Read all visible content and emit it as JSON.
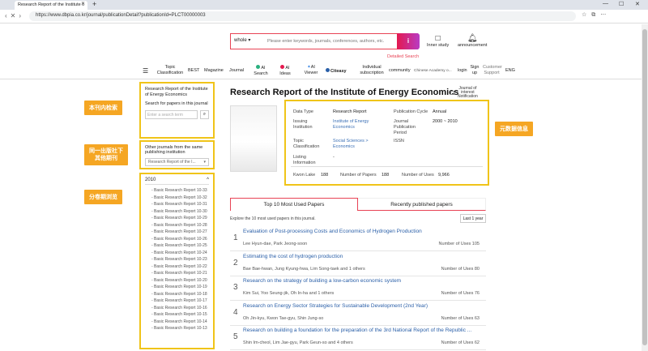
{
  "browser": {
    "tab_title": "Research Report of the Institute o",
    "url": "https://www.dbpia.co.kr/journal/publicationDetail?publicationId=PLCT00000003"
  },
  "search": {
    "scope": "whole",
    "placeholder": "Please enter keywords, journals, conferences, authors, etc.",
    "detailed": "Detailed Search"
  },
  "top_links": {
    "inner_study": "Inner study",
    "announcement": "announcement"
  },
  "menu": {
    "topic": "Topic Classification",
    "best": "BEST",
    "magazine": "Magazine",
    "journal": "Journal",
    "ai_search": "AI Search",
    "ai_ideas": "AI Ideas",
    "ai_viewer": "AI Viewer",
    "citeasy": "Citeasy",
    "individual": "Individual subscription",
    "community": "community",
    "academy": "Chinese Academy o...",
    "login": "login",
    "signup": "Sign up",
    "customer": "Customer Support",
    "lang": "ENG"
  },
  "sidebar": {
    "box1_title": "Research Report of the Institute of Energy Economics",
    "box1_sub": "Search for papers in this journal",
    "search_placeholder": "Enter a search term",
    "box2_title": "Other journals from the same publishing institution",
    "box2_select": "Research Report of the I...",
    "year": "2010",
    "volumes": [
      "Basic Research Report 10-33",
      "Basic Research Report 10-32",
      "Basic Research Report 10-31",
      "Basic Research Report 10-30",
      "Basic Research Report 10-29",
      "Basic Research Report 10-28",
      "Basic Research Report 10-27",
      "Basic Research Report 10-26",
      "Basic Research Report 10-25",
      "Basic Research Report 10-24",
      "Basic Research Report 10-23",
      "Basic Research Report 10-22",
      "Basic Research Report 10-21",
      "Basic Research Report 10-20",
      "Basic Research Report 10-19",
      "Basic Research Report 10-18",
      "Basic Research Report 10-17",
      "Basic Research Report 10-16",
      "Basic Research Report 10-15",
      "Basic Research Report 10-14",
      "Basic Research Report 10-13"
    ]
  },
  "annotations": {
    "a1": "本刊内检索",
    "a2": "同一出版社下其他期刊",
    "a3": "分卷期浏览",
    "a4": "元数据信息"
  },
  "journal": {
    "title": "Research Report of the Institute of Energy Economics",
    "notification": "Journal of interest Notification"
  },
  "meta": {
    "data_type_label": "Data Type",
    "data_type": "Research Report",
    "issuing_label": "Issuing Institution",
    "issuing": "Institute of Energy Economics",
    "topic_label": "Topic Classification",
    "topic": "Social Sciences > Economics",
    "listing_label": "Listing Information",
    "listing": "-",
    "cycle_label": "Publication Cycle",
    "cycle": "Annual",
    "period_label": "Journal Publication Period",
    "period": "2000 ~ 2010",
    "issn_label": "ISSN",
    "issn": "",
    "kwon_label": "Kwon Lake",
    "kwon": "188",
    "papers_label": "Number of Papers",
    "papers": "188",
    "uses_label": "Number of Uses",
    "uses": "9,966"
  },
  "tabs": {
    "top10": "Top 10 Most Used Papers",
    "recent": "Recently published papers"
  },
  "explore": "Explore the 10 most used papers in this journal.",
  "period_select": "Last 1 year",
  "papers": [
    {
      "num": "1",
      "title": "Evaluation of Post-processing Costs and Economics of Hydrogen Production",
      "authors": "Lee Hyun-dae, Park Jeong-soon",
      "uses": "Number of Uses 105"
    },
    {
      "num": "2",
      "title": "Estimating the cost of hydrogen production",
      "authors": "Bae Bae-hwan, Jung Kyung-hwa, Lim Song-taek and 1 others",
      "uses": "Number of Uses 80"
    },
    {
      "num": "3",
      "title": "Research on the strategy of building a low-carbon economic system",
      "authors": "Kim Sui, Yoo Seung-jik, Oh In-ha and 1 others",
      "uses": "Number of Uses 76"
    },
    {
      "num": "4",
      "title": "Research on Energy Sector Strategies for Sustainable Development (2nd Year)",
      "authors": "Oh Jin-kyu, Kwon Tae-gyu, Shin Jung-so",
      "uses": "Number of Uses 63"
    },
    {
      "num": "5",
      "title": "Research on building a foundation for the preparation of the 3rd National Report of the Republic ...",
      "authors": "Shin Im-cheol, Lim Jae-gyu, Park Geun-so and 4 others",
      "uses": "Number of Uses 62"
    }
  ]
}
